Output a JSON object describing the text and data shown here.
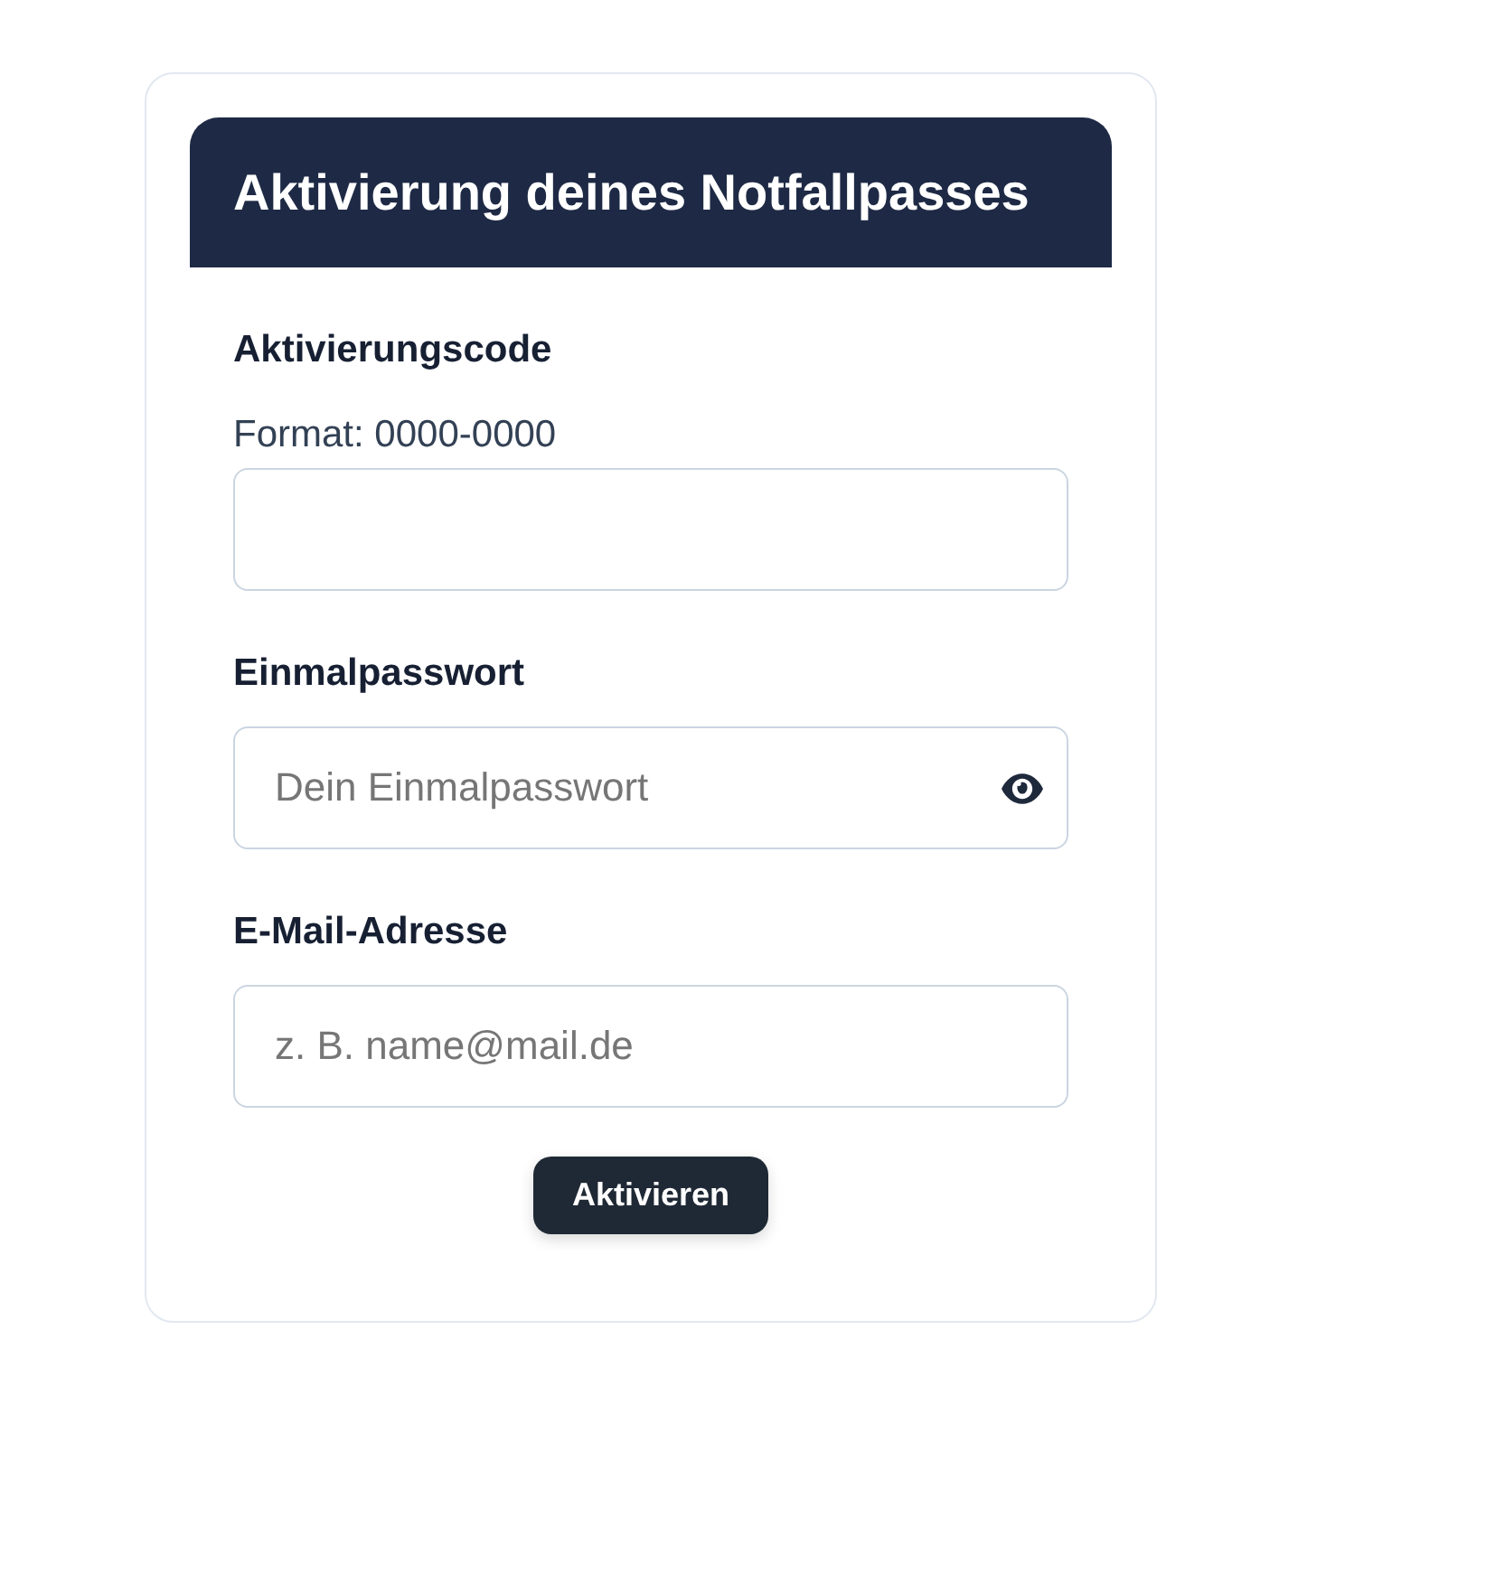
{
  "header": {
    "title": "Aktivierung deines Notfallpasses"
  },
  "fields": [
    {
      "kind": "text",
      "label": "Aktivierungscode",
      "hint": "Format: 0000-0000"
    },
    {
      "kind": "password",
      "label": "Einmalpasswort",
      "placeholder": "Dein Einmalpasswort"
    },
    {
      "kind": "email",
      "label": "E-Mail-Adresse",
      "placeholder": "z. B. name@mail.de"
    }
  ],
  "submit": {
    "label": "Aktivieren"
  }
}
